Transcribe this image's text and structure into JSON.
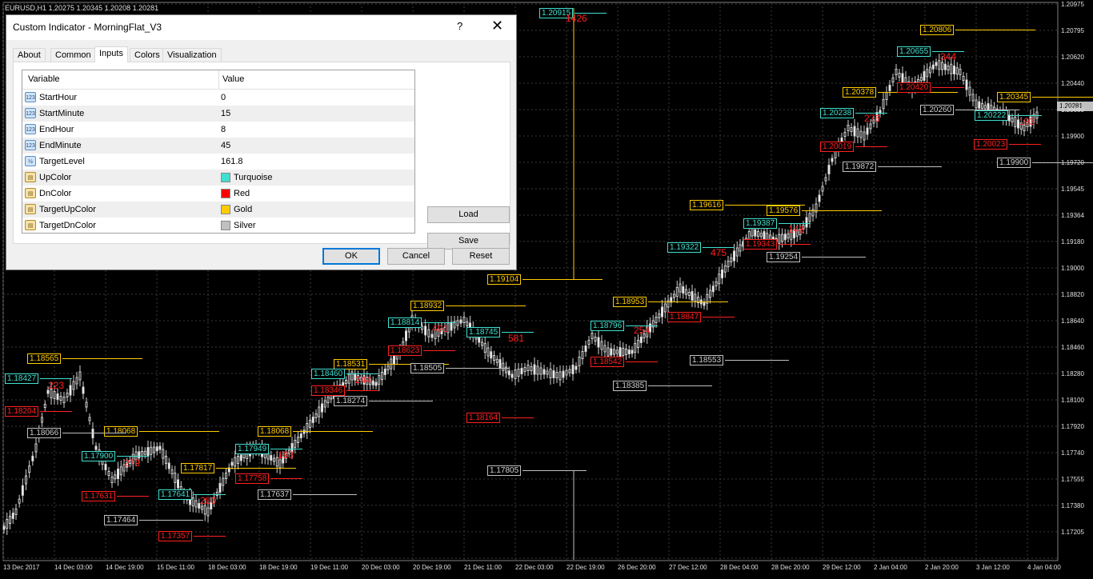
{
  "chart": {
    "symbol_header": "EURUSD,H1  1.20275 1.20345 1.20208 1.20281",
    "current_price": "1.20281",
    "price_axis": [
      "1.20975",
      "1.20795",
      "1.20620",
      "1.20440",
      "1.20080",
      "1.19900",
      "1.19720",
      "1.19545",
      "1.19364",
      "1.19180",
      "1.19000",
      "1.18820",
      "1.18640",
      "1.18460",
      "1.18280",
      "1.18100",
      "1.17920",
      "1.17740",
      "1.17555",
      "1.17380",
      "1.17205"
    ],
    "time_axis": [
      "13 Dec 2017",
      "14 Dec 03:00",
      "14 Dec 19:00",
      "15 Dec 11:00",
      "18 Dec 03:00",
      "18 Dec 19:00",
      "19 Dec 11:00",
      "20 Dec 03:00",
      "20 Dec 19:00",
      "21 Dec 11:00",
      "22 Dec 03:00",
      "22 Dec 19:00",
      "26 Dec 20:00",
      "27 Dec 12:00",
      "28 Dec 04:00",
      "28 Dec 20:00",
      "29 Dec 12:00",
      "2 Jan 04:00",
      "2 Jan 20:00",
      "3 Jan 12:00",
      "4 Jan 04:00"
    ],
    "price_labels": [
      {
        "t": "1.20915",
        "c": "tq"
      },
      {
        "t": "1.20806",
        "c": "gd"
      },
      {
        "t": "1.20655",
        "c": "tq"
      },
      {
        "t": "1.20378",
        "c": "gd"
      },
      {
        "t": "1.20345",
        "c": "gd"
      },
      {
        "t": "1.20260",
        "c": "sv"
      },
      {
        "t": "1.20238",
        "c": "tq"
      },
      {
        "t": "1.20222",
        "c": "tq"
      },
      {
        "t": "1.20023",
        "c": "rd"
      },
      {
        "t": "1.20019",
        "c": "rd"
      },
      {
        "t": "1.20420",
        "c": "rd"
      },
      {
        "t": "1.19900",
        "c": "sv"
      },
      {
        "t": "1.19872",
        "c": "sv"
      },
      {
        "t": "1.19616",
        "c": "gd"
      },
      {
        "t": "1.19576",
        "c": "gd"
      },
      {
        "t": "1.19387",
        "c": "tq"
      },
      {
        "t": "1.19343",
        "c": "rd"
      },
      {
        "t": "1.19322",
        "c": "tq"
      },
      {
        "t": "1.19254",
        "c": "sv"
      },
      {
        "t": "1.19104",
        "c": "gd"
      },
      {
        "t": "1.18953",
        "c": "gd"
      },
      {
        "t": "1.18932",
        "c": "gd"
      },
      {
        "t": "1.18847",
        "c": "rd"
      },
      {
        "t": "1.18814",
        "c": "tq"
      },
      {
        "t": "1.18796",
        "c": "tq"
      },
      {
        "t": "1.18745",
        "c": "tq"
      },
      {
        "t": "1.18623",
        "c": "rd"
      },
      {
        "t": "1.18565",
        "c": "gd"
      },
      {
        "t": "1.18553",
        "c": "sv"
      },
      {
        "t": "1.18542",
        "c": "rd"
      },
      {
        "t": "1.18531",
        "c": "gd"
      },
      {
        "t": "1.18505",
        "c": "sv"
      },
      {
        "t": "1.18460",
        "c": "tq"
      },
      {
        "t": "1.18427",
        "c": "tq"
      },
      {
        "t": "1.18385",
        "c": "sv"
      },
      {
        "t": "1.18346",
        "c": "rd"
      },
      {
        "t": "1.18274",
        "c": "sv"
      },
      {
        "t": "1.18204",
        "c": "rd"
      },
      {
        "t": "1.18164",
        "c": "rd"
      },
      {
        "t": "1.18068",
        "c": "gd"
      },
      {
        "t": "1.18068",
        "c": "gd"
      },
      {
        "t": "1.18066",
        "c": "sv"
      },
      {
        "t": "1.17949",
        "c": "tq"
      },
      {
        "t": "1.17900",
        "c": "tq"
      },
      {
        "t": "1.17817",
        "c": "gd"
      },
      {
        "t": "1.17805",
        "c": "sv"
      },
      {
        "t": "1.17758",
        "c": "rd"
      },
      {
        "t": "1.17641",
        "c": "tq"
      },
      {
        "t": "1.17637",
        "c": "sv"
      },
      {
        "t": "1.17631",
        "c": "rd"
      },
      {
        "t": "1.17464",
        "c": "sv"
      },
      {
        "t": "1.17357",
        "c": "rd"
      }
    ],
    "range_points": [
      "1426",
      "344",
      "276",
      "193",
      "148",
      "475",
      "254",
      "491",
      "581",
      "193",
      "279",
      "280",
      "223",
      "244"
    ]
  },
  "dialog": {
    "title": "Custom Indicator - MorningFlat_V3",
    "help": "?",
    "close": "✕",
    "tabs": [
      "About",
      "Common",
      "Inputs",
      "Colors",
      "Visualization"
    ],
    "active_tab": "Inputs",
    "columns": {
      "variable": "Variable",
      "value": "Value"
    },
    "rows": [
      {
        "icon": "123",
        "name": "StartHour",
        "value": "0"
      },
      {
        "icon": "123",
        "name": "StartMinute",
        "value": "15"
      },
      {
        "icon": "123",
        "name": "EndHour",
        "value": "8"
      },
      {
        "icon": "123",
        "name": "EndMinute",
        "value": "45"
      },
      {
        "icon": "½",
        "name": "TargetLevel",
        "value": "161.8"
      },
      {
        "icon": "clr",
        "name": "UpColor",
        "value": "Turquoise",
        "color": "#40e0d0"
      },
      {
        "icon": "clr",
        "name": "DnColor",
        "value": "Red",
        "color": "#ff0000"
      },
      {
        "icon": "clr",
        "name": "TargetUpColor",
        "value": "Gold",
        "color": "#ffcc00"
      },
      {
        "icon": "clr",
        "name": "TargetDnColor",
        "value": "Silver",
        "color": "#c0c0c0"
      }
    ],
    "buttons": {
      "load": "Load",
      "save": "Save",
      "ok": "OK",
      "cancel": "Cancel",
      "reset": "Reset"
    }
  }
}
